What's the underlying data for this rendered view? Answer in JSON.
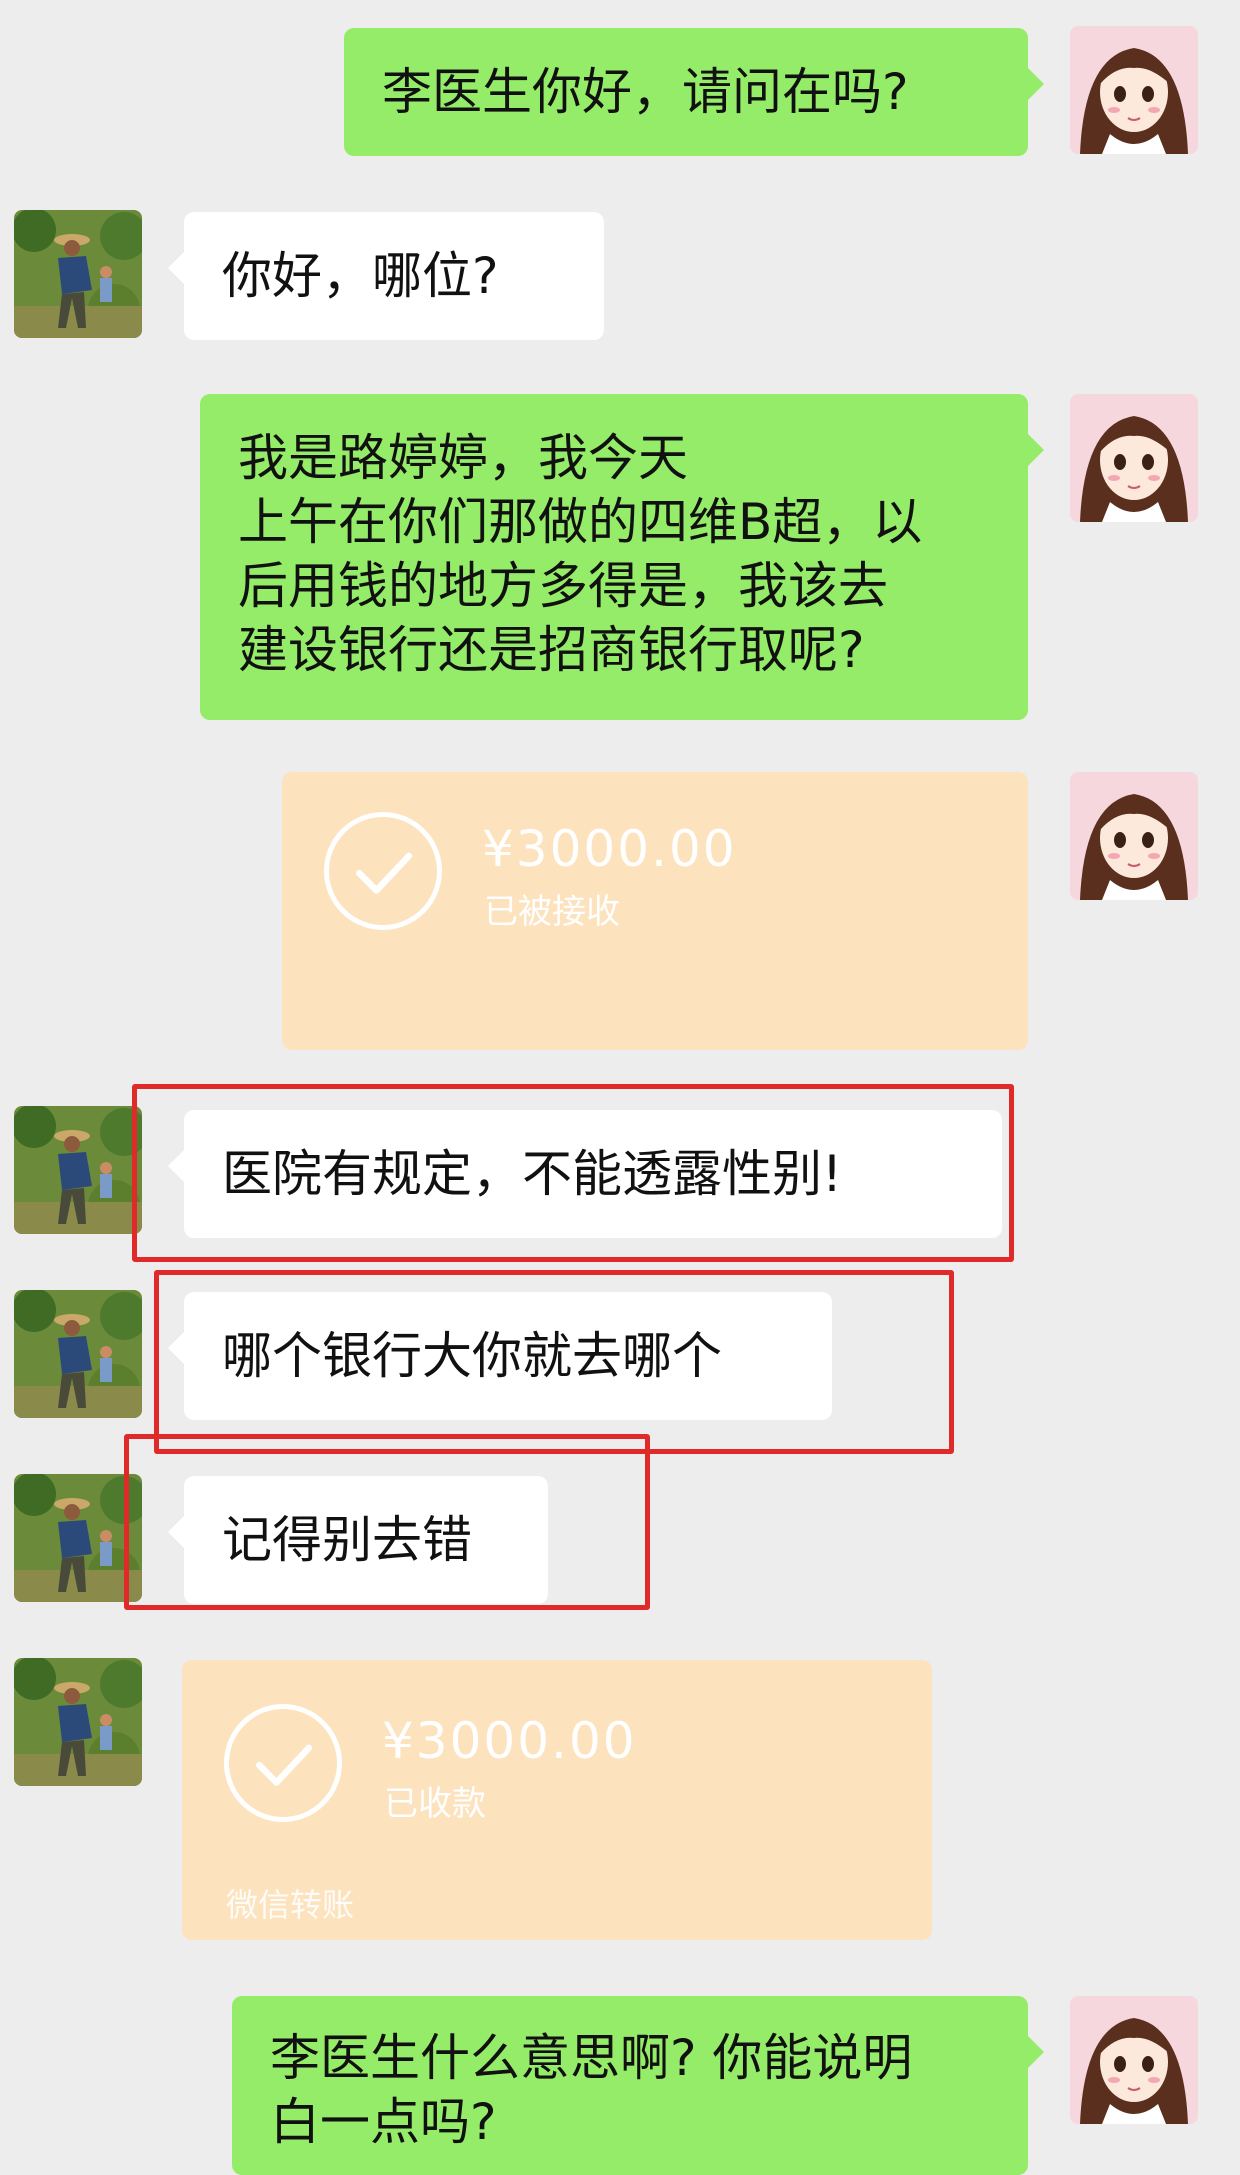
{
  "messages": [
    {
      "from": "me",
      "text": "李医生你好，请问在吗?"
    },
    {
      "from": "other",
      "text": "你好，哪位?"
    },
    {
      "from": "me",
      "lines": [
        "我是路婷婷，我今天",
        "上午在你们那做的四维B超，以",
        "后用钱的地方多得是，我该去",
        "建设银行还是招商银行取呢?"
      ]
    },
    {
      "from": "me",
      "type": "transfer",
      "amount": "¥3000.00",
      "status": "已被接收",
      "footer": ""
    },
    {
      "from": "other",
      "text": "医院有规定，不能透露性别!"
    },
    {
      "from": "other",
      "text": "哪个银行大你就去哪个"
    },
    {
      "from": "other",
      "text": "记得别去错"
    },
    {
      "from": "other",
      "type": "transfer",
      "amount": "¥3000.00",
      "status": "已收款",
      "footer": "微信转账"
    },
    {
      "from": "me",
      "lines": [
        "李医生什么意思啊? 你能说明",
        "白一点吗?"
      ]
    }
  ],
  "colors": {
    "me_bubble": "#95ec69",
    "other_bubble": "#ffffff",
    "transfer": "#fde2be",
    "highlight": "#e02a2a",
    "background": "#ededed"
  },
  "avatars": {
    "me": "cartoon-girl-avatar",
    "other": "farmer-photo-avatar"
  }
}
